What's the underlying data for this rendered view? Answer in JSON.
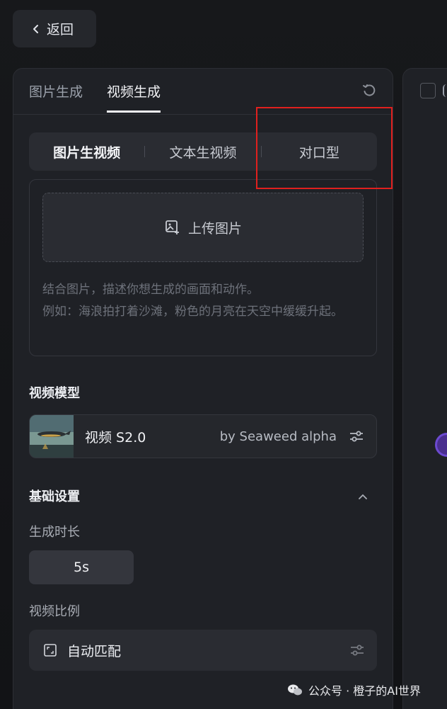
{
  "back": {
    "label": "返回"
  },
  "top_tabs": [
    {
      "label": "图片生成",
      "active": false
    },
    {
      "label": "视频生成",
      "active": true
    }
  ],
  "segment": [
    {
      "label": "图片生视频",
      "active": true
    },
    {
      "label": "文本生视频",
      "active": false
    },
    {
      "label": "对口型",
      "active": false
    }
  ],
  "upload": {
    "label": "上传图片"
  },
  "prompt": {
    "placeholder_line1": "结合图片，描述你想生成的画面和动作。",
    "placeholder_line2": "例如：海浪拍打着沙滩，粉色的月亮在天空中缓缓升起。"
  },
  "video_model": {
    "section_title": "视频模型",
    "name": "视频 S2.0",
    "by": "by Seaweed alpha"
  },
  "basic_settings": {
    "section_title": "基础设置",
    "duration_label": "生成时长",
    "duration_value": "5s",
    "ratio_label": "视频比例",
    "ratio_value": "自动匹配"
  },
  "watermark": {
    "text": "公众号 · 橙子的AI世界"
  },
  "colors": {
    "highlight": "#e0201e",
    "accent_purple": "#6c4ad0",
    "panel_bg": "#1f2126"
  },
  "icons": [
    "chevron-left-icon",
    "reset-icon",
    "image-add-icon",
    "sliders-icon",
    "chevron-up-icon",
    "frame-icon",
    "wechat-icon"
  ]
}
